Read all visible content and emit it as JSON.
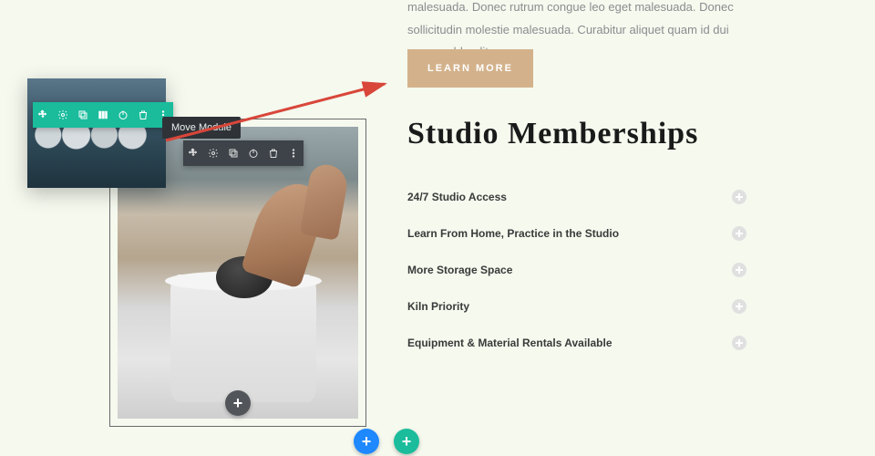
{
  "intro_text": "malesuada. Donec rutrum congue leo eget malesuada. Donec sollicitudin molestie malesuada. Curabitur aliquet quam id dui posuere blandit.",
  "learn_more_label": "LEARN MORE",
  "memberships_heading": "Studio Memberships",
  "accordion": [
    {
      "label": "24/7 Studio Access"
    },
    {
      "label": "Learn From Home, Practice in the Studio"
    },
    {
      "label": "More Storage Space"
    },
    {
      "label": "Kiln Priority"
    },
    {
      "label": "Equipment & Material Rentals Available"
    }
  ],
  "tooltip_text": "Move Module",
  "toolbar_icons": [
    "move",
    "settings",
    "duplicate",
    "columns",
    "power",
    "delete",
    "more"
  ],
  "module_toolbar_icons": [
    "move",
    "settings",
    "duplicate",
    "power",
    "delete",
    "more"
  ],
  "add_glyph": "+"
}
